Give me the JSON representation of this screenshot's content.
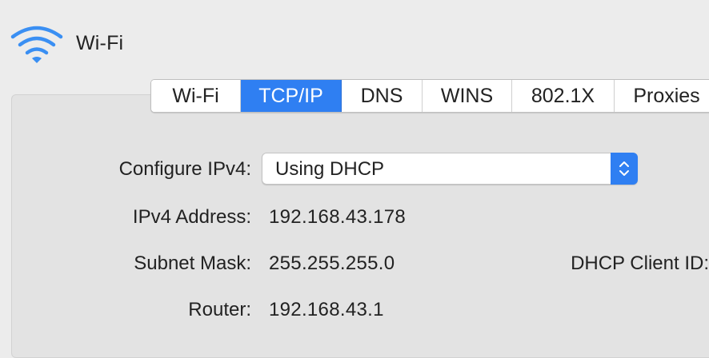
{
  "header": {
    "title": "Wi-Fi",
    "icon": "wifi-icon",
    "icon_color": "#3a8ff3"
  },
  "tabs": [
    {
      "label": "Wi-Fi",
      "active": false
    },
    {
      "label": "TCP/IP",
      "active": true
    },
    {
      "label": "DNS",
      "active": false
    },
    {
      "label": "WINS",
      "active": false
    },
    {
      "label": "802.1X",
      "active": false
    },
    {
      "label": "Proxies",
      "active": false
    }
  ],
  "form": {
    "configure_ipv4": {
      "label": "Configure IPv4:",
      "value": "Using DHCP"
    },
    "ipv4_address": {
      "label": "IPv4 Address:",
      "value": "192.168.43.178"
    },
    "subnet_mask": {
      "label": "Subnet Mask:",
      "value": "255.255.255.0"
    },
    "router": {
      "label": "Router:",
      "value": "192.168.43.1"
    },
    "dhcp_client_id": {
      "label": "DHCP Client ID:"
    }
  },
  "colors": {
    "accent": "#2f7ff2",
    "background": "#ececec",
    "panel": "#e3e3e3"
  }
}
